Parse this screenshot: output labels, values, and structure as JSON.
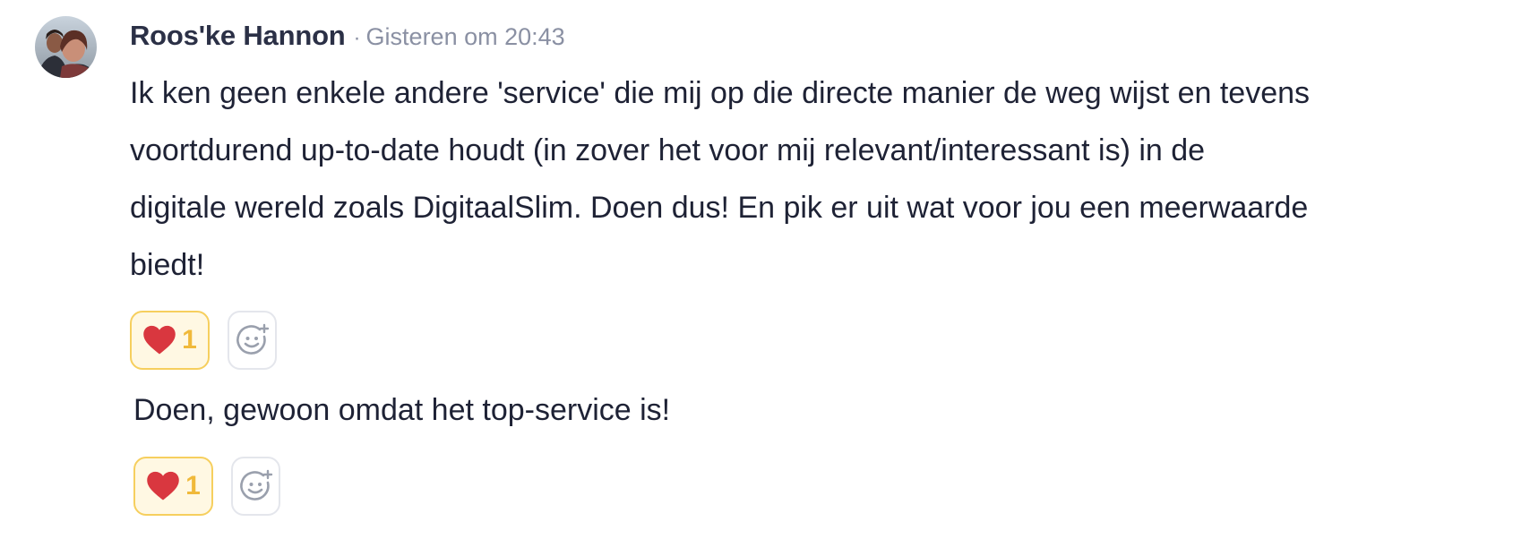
{
  "post": {
    "author": "Roos'ke Hannon",
    "separator": "·",
    "timestamp": "Gisteren om 20:43",
    "avatar_icon": "profile-photo",
    "body": "Ik ken geen enkele andere 'service' die mij op die directe manier de weg wijst en tevens\nvoortdurend up-to-date  houdt (in zover het voor mij relevant/interessant is) in de\ndigitale wereld zoals DigitaalSlim. Doen dus! En pik er uit wat voor jou een meerwaarde\nbiedt!",
    "reactions": [
      {
        "icon": "heart-icon",
        "count": "1",
        "color": "#d9373f"
      }
    ],
    "add_reaction_icon": "add-emoji-icon"
  },
  "reply": {
    "body": "Doen, gewoon omdat het top-service is!",
    "reactions": [
      {
        "icon": "heart-icon",
        "count": "1",
        "color": "#d9373f"
      }
    ],
    "add_reaction_icon": "add-emoji-icon"
  },
  "colors": {
    "reaction_border": "#f6cf5e",
    "reaction_bg": "#fff8e3",
    "reaction_count": "#f0b93a",
    "muted_text": "#8a90a3",
    "body_text": "#1e2235"
  }
}
